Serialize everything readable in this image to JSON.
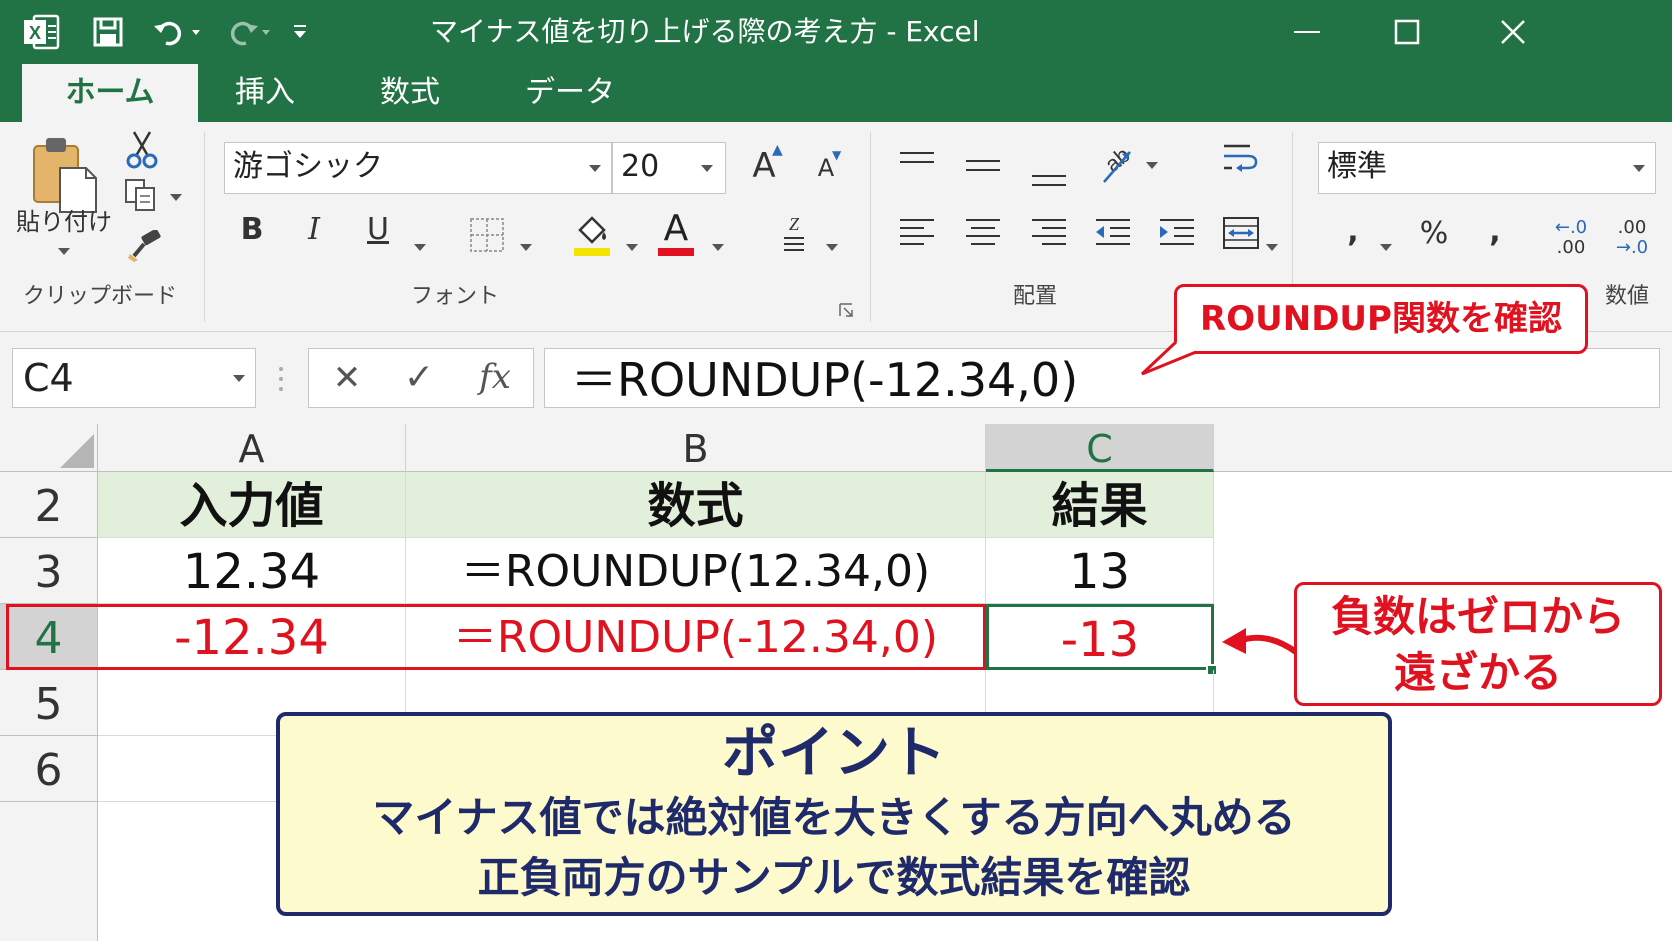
{
  "title_bar": {
    "title": "マイナス値を切り上げる際の考え方 - Excel",
    "excel_icon": "excel-logo-icon",
    "save_icon": "save-icon",
    "undo_icon": "undo-icon",
    "redo_icon": "redo-icon",
    "qat_icon": "customize-quick-access-icon",
    "minimize_icon": "minimize-icon",
    "maximize_icon": "maximize-icon",
    "close_icon": "close-icon"
  },
  "tabs": [
    {
      "label": "ホーム",
      "active": true
    },
    {
      "label": "挿入",
      "active": false
    },
    {
      "label": "数式",
      "active": false
    },
    {
      "label": "データ",
      "active": false
    }
  ],
  "ribbon": {
    "clipboard": {
      "paste_label": "貼り付け",
      "group_label": "クリップボード"
    },
    "font": {
      "font_name": "游ゴシック",
      "font_size": "20",
      "bold": "B",
      "italic": "I",
      "underline": "U",
      "font_color_glyph": "A",
      "grow_glyph": "A",
      "shrink_glyph": "A",
      "group_label": "フォント",
      "highlight_color": "#f5e400",
      "font_color": "#e0121f"
    },
    "alignment": {
      "group_label": "配置"
    },
    "number": {
      "format": "標準",
      "percent": "%",
      "comma": ",",
      "inc_decimal_top": "←.0",
      "inc_decimal_bottom": ".00",
      "dec_decimal_top": ".00",
      "dec_decimal_bottom": "→.0",
      "group_label": "数値"
    }
  },
  "formula_bar": {
    "name_box": "C4",
    "cancel_glyph": "✕",
    "enter_glyph": "✓",
    "fx_glyph": "fx",
    "formula": "＝ROUNDUP(-12.34,0)"
  },
  "columns": [
    "A",
    "B",
    "C"
  ],
  "rows": [
    {
      "num": "2",
      "a": "入力値",
      "b": "数式",
      "c": "結果"
    },
    {
      "num": "3",
      "a": "12.34",
      "b": "＝ROUNDUP(12.34,0)",
      "c": "13"
    },
    {
      "num": "4",
      "a": "-12.34",
      "b": "＝ROUNDUP(-12.34,0)",
      "c": "-13"
    },
    {
      "num": "5",
      "a": "",
      "b": "",
      "c": ""
    },
    {
      "num": "6",
      "a": "",
      "b": "",
      "c": ""
    }
  ],
  "callouts": {
    "top": "ROUNDUP関数を確認",
    "right_line1": "負数はゼロから",
    "right_line2": "遠ざかる"
  },
  "point_box": {
    "title": "ポイント",
    "line1": "マイナス値では絶対値を大きくする方向へ丸める",
    "line2": "正負両方のサンプルで数式結果を確認"
  },
  "colors": {
    "excel_green": "#217346",
    "highlight_red": "#e0121f",
    "header_fill": "#e2efda",
    "point_fill": "#fdfacd",
    "point_border": "#1f2a6b"
  }
}
